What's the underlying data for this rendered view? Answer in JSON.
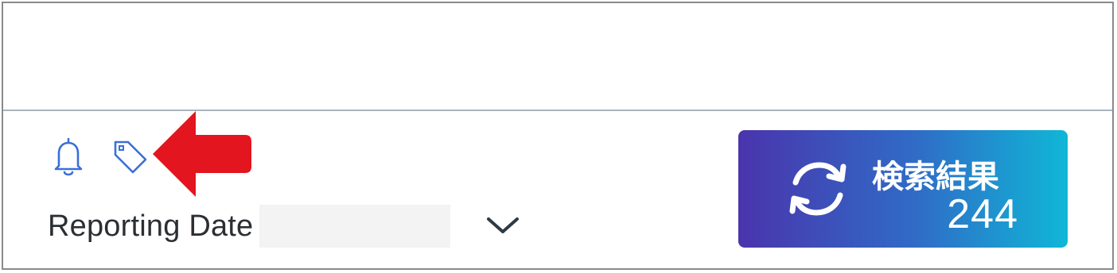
{
  "filter": {
    "label": "Reporting Date",
    "value": "",
    "placeholder": ""
  },
  "toolbar": {
    "icons": [
      "bell-icon",
      "tag-icon"
    ]
  },
  "annotation": {
    "arrow_color": "#e3151f",
    "points_to": "tag-icon"
  },
  "results_button": {
    "label": "検索結果",
    "count": "244",
    "icon": "refresh-icon",
    "gradient_start": "#4a34ad",
    "gradient_end": "#0fb7d6"
  }
}
